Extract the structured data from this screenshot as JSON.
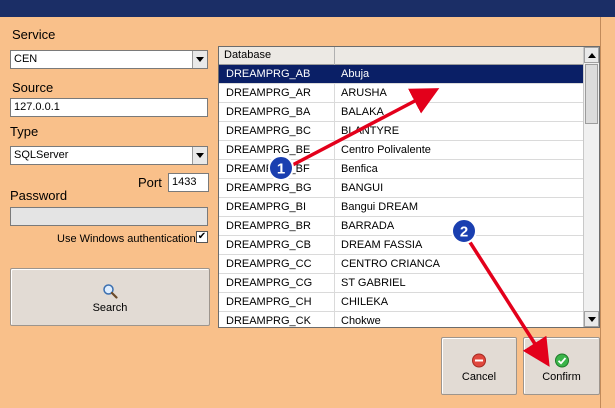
{
  "form": {
    "service_label": "Service",
    "service_value": "CEN",
    "source_label": "Source",
    "source_value": "127.0.0.1",
    "type_label": "Type",
    "type_value": "SQLServer",
    "port_label": "Port",
    "port_value": "1433",
    "password_label": "Password",
    "password_value": "",
    "windows_auth_label": "Use Windows authentication",
    "windows_auth_checked": "✔",
    "search_label": "Search"
  },
  "grid": {
    "header": {
      "col1": "Database",
      "col2": ""
    },
    "rows": [
      {
        "db": "DREAMPRG_AB",
        "name": "Abuja"
      },
      {
        "db": "DREAMPRG_AR",
        "name": "ARUSHA"
      },
      {
        "db": "DREAMPRG_BA",
        "name": "BALAKA"
      },
      {
        "db": "DREAMPRG_BC",
        "name": "BLANTYRE"
      },
      {
        "db": "DREAMPRG_BE",
        "name": "Centro Polivalente"
      },
      {
        "db": "DREAMPRG_BF",
        "name": "Benfica"
      },
      {
        "db": "DREAMPRG_BG",
        "name": "BANGUI"
      },
      {
        "db": "DREAMPRG_BI",
        "name": "Bangui DREAM"
      },
      {
        "db": "DREAMPRG_BR",
        "name": "BARRADA"
      },
      {
        "db": "DREAMPRG_CB",
        "name": "DREAM FASSIA"
      },
      {
        "db": "DREAMPRG_CC",
        "name": "CENTRO CRIANCA"
      },
      {
        "db": "DREAMPRG_CG",
        "name": "ST GABRIEL"
      },
      {
        "db": "DREAMPRG_CH",
        "name": "CHILEKA"
      },
      {
        "db": "DREAMPRG_CK",
        "name": "Chokwe"
      }
    ],
    "selected_index": 0
  },
  "buttons": {
    "cancel_label": "Cancel",
    "confirm_label": "Confirm"
  },
  "annotations": {
    "badge1": "1",
    "badge2": "2"
  },
  "colors": {
    "background": "#f9c08a",
    "title_bar": "#1b2e66",
    "selection": "#0a1f66",
    "annotation_red": "#e3001b",
    "badge_blue": "#1a3fb0"
  },
  "icons": {
    "search": "magnifier-icon",
    "cancel": "red-circle-icon",
    "confirm": "green-check-icon"
  }
}
